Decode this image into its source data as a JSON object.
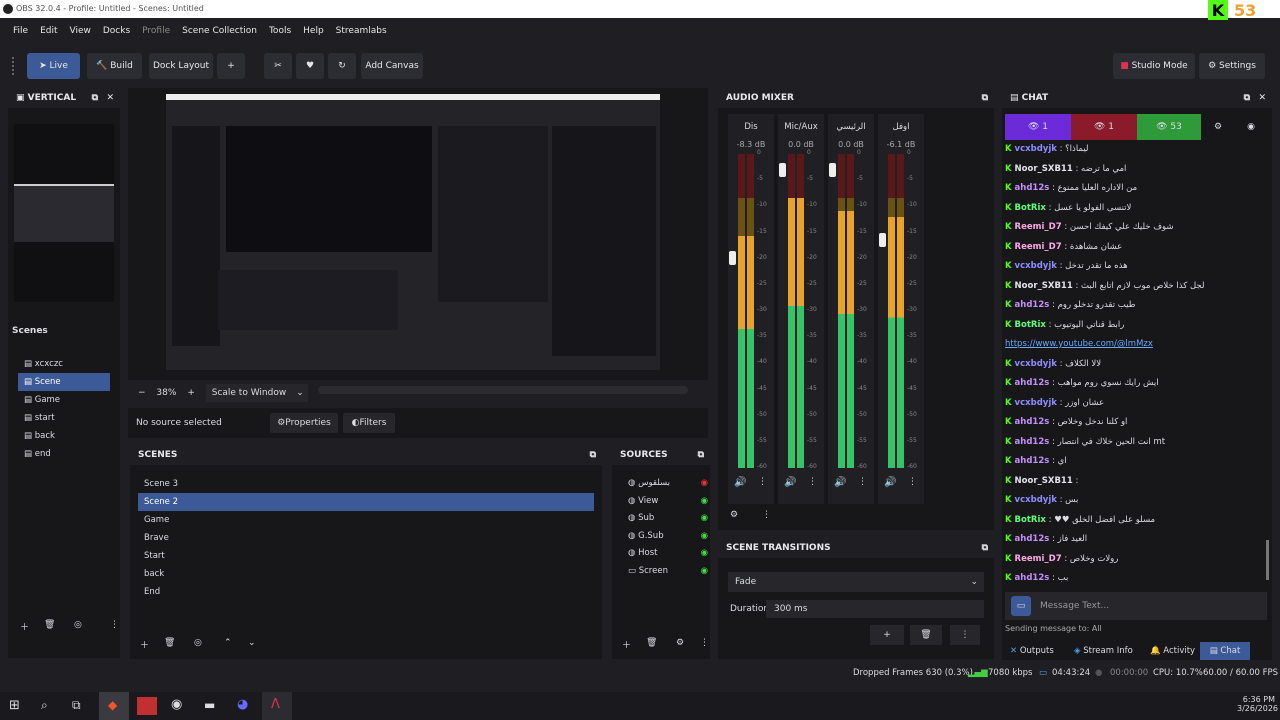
{
  "window": {
    "title": "OBS 32.0.4 - Profile: Untitled - Scenes: Untitled"
  },
  "menu": [
    "File",
    "Edit",
    "View",
    "Docks",
    "Profile",
    "Scene Collection",
    "Tools",
    "Help",
    "Streamlabs"
  ],
  "toolbar": {
    "live": "Live",
    "build": "Build",
    "dock_layout": "Dock Layout",
    "plus": "+",
    "add_canvas": "Add Canvas",
    "studio_mode": "Studio Mode",
    "settings": "Settings"
  },
  "vertical": {
    "title": "VERTICAL",
    "scenes_label": "Scenes",
    "scenes": [
      "xcxczc",
      "Scene",
      "Game",
      "start",
      "back",
      "end"
    ],
    "selected": 1
  },
  "preview": {
    "zoom": "38%",
    "scale": "Scale to Window",
    "no_source": "No source selected",
    "properties": "Properties",
    "filters": "Filters"
  },
  "scenes": {
    "title": "SCENES",
    "items": [
      "Scene 3",
      "Scene 2",
      "Game",
      "Brave",
      "Start",
      "back",
      "End"
    ],
    "selected": 1
  },
  "sources": {
    "title": "SOURCES",
    "items": [
      "بسلقوس",
      "View",
      "Sub",
      "G.Sub",
      "Host",
      "Screen"
    ]
  },
  "mixer": {
    "title": "AUDIO MIXER",
    "channels": [
      {
        "name": "Dis",
        "db": "-8.3 dB",
        "level": 0.74,
        "fader": 0.31
      },
      {
        "name": "Mic/Aux",
        "db": "0.0 dB",
        "level": 0.86,
        "fader": 0.03
      },
      {
        "name": "الرئيسي",
        "db": "0.0 dB",
        "level": 0.82,
        "fader": 0.03
      },
      {
        "name": "اوفل",
        "db": "-6.1 dB",
        "level": 0.8,
        "fader": 0.25
      }
    ],
    "scale": [
      "0",
      "-5",
      "-10",
      "-15",
      "-20",
      "-25",
      "-30",
      "-35",
      "-40",
      "-45",
      "-50",
      "-55",
      "-60"
    ]
  },
  "transitions": {
    "title": "SCENE TRANSITIONS",
    "type": "Fade",
    "duration_label": "Duration",
    "duration": "300 ms"
  },
  "chat": {
    "title": "CHAT",
    "count_purple": "1",
    "count_red": "1",
    "count_green": "53",
    "messages": [
      {
        "user": "vcxbdyjk",
        "cls": "u1",
        "text": "ليماذا؟"
      },
      {
        "user": "Noor_SXB11",
        "cls": "u3",
        "text": "امي ما ترضه"
      },
      {
        "user": "ahd12s",
        "cls": "u2",
        "text": "من الاداره العليا ممنوع"
      },
      {
        "user": "BotRix",
        "cls": "u5",
        "text": "لاتنسى الفولو يا عسل"
      },
      {
        "user": "Reemi_D7",
        "cls": "u4",
        "text": "شوف خليك علي كيفك احسن"
      },
      {
        "user": "Reemi_D7",
        "cls": "u4",
        "text": "عشان مشاهدة"
      },
      {
        "user": "vcxbdyjk",
        "cls": "u1",
        "text": "هذه ما تقدر تدخل"
      },
      {
        "user": "Noor_SXB11",
        "cls": "u3",
        "text": "لجل كذا خلاص موب لازم اتابع البث"
      },
      {
        "user": "ahd12s",
        "cls": "u2",
        "text": "طيب تقدرو تدخلو روم"
      },
      {
        "user": "BotRix",
        "cls": "u5",
        "text": "رابط قناتي اليوتيوب"
      },
      {
        "user": "",
        "cls": "",
        "text": "https://www.youtube.com/@lmMzx"
      },
      {
        "user": "vcxbdyjk",
        "cls": "u1",
        "text": "لالا الكلاف"
      },
      {
        "user": "ahd12s",
        "cls": "u2",
        "text": "ايش رايك نسوي روم مواهب"
      },
      {
        "user": "vcxbdyjk",
        "cls": "u1",
        "text": "عشان اوزر"
      },
      {
        "user": "ahd12s",
        "cls": "u2",
        "text": "او كلنا ندخل وخلاص"
      },
      {
        "user": "ahd12s",
        "cls": "u2",
        "text": "انت الحين خلاك في انتصار mt"
      },
      {
        "user": "ahd12s",
        "cls": "u2",
        "text": "اي"
      },
      {
        "user": "Noor_SXB11",
        "cls": "u3",
        "text": ""
      },
      {
        "user": "vcxbdyjk",
        "cls": "u1",
        "text": "بس"
      },
      {
        "user": "BotRix",
        "cls": "u5",
        "text": "♥♥ مسلو على افضل الخلق"
      },
      {
        "user": "ahd12s",
        "cls": "u2",
        "text": "العيد فاز"
      },
      {
        "user": "Reemi_D7",
        "cls": "u4",
        "text": "رولات وخلاص"
      },
      {
        "user": "ahd12s",
        "cls": "u2",
        "text": "بب"
      }
    ],
    "placeholder": "Message Text...",
    "sending": "Sending message to: All",
    "tabs": [
      "Outputs",
      "Stream Info",
      "Activity",
      "Chat"
    ]
  },
  "status": {
    "dropped": "Dropped Frames 630 (0.3%)",
    "kbps": "7080 kbps",
    "time1": "04:43:24",
    "time2": "00:00:00",
    "cpu": "CPU: 10.7%",
    "fps": "60.00 / 60.00 FPS"
  },
  "taskbar": {
    "time": "6:36 PM",
    "date": "3/26/2026"
  },
  "brand": {
    "kick_count": "53"
  }
}
